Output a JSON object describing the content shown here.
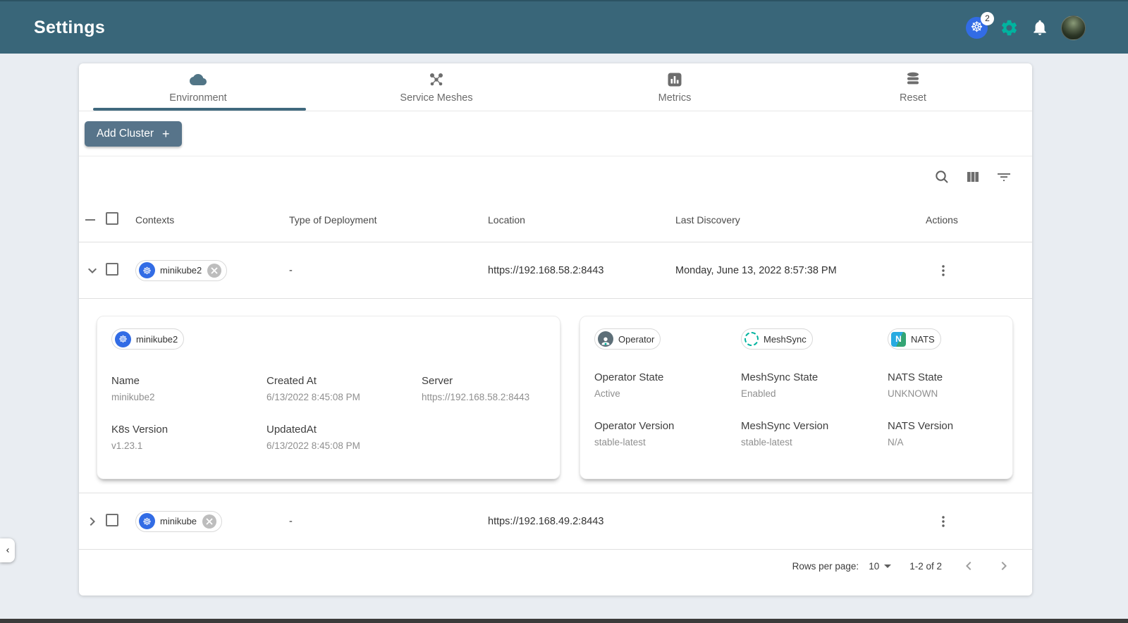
{
  "header": {
    "title": "Settings",
    "context_badge": "2"
  },
  "tabs": [
    {
      "label": "Environment",
      "icon": "cloud",
      "active": true
    },
    {
      "label": "Service Meshes",
      "icon": "mesh",
      "active": false
    },
    {
      "label": "Metrics",
      "icon": "bar-chart",
      "active": false
    },
    {
      "label": "Reset",
      "icon": "database",
      "active": false
    }
  ],
  "actions_bar": {
    "add_cluster": "Add Cluster",
    "plus": "+"
  },
  "table": {
    "columns": {
      "contexts": "Contexts",
      "type": "Type of Deployment",
      "location": "Location",
      "discovery": "Last Discovery",
      "actions": "Actions"
    },
    "rows": [
      {
        "name": "minikube2",
        "type": "-",
        "location": "https://192.168.58.2:8443",
        "discovery": "Monday, June 13, 2022 8:57:38 PM"
      },
      {
        "name": "minikube",
        "type": "-",
        "location": "https://192.168.49.2:8443",
        "discovery": ""
      }
    ]
  },
  "detail": {
    "chip": "minikube2",
    "cluster_fields": [
      {
        "label": "Name",
        "value": "minikube2"
      },
      {
        "label": "Created At",
        "value": "6/13/2022 8:45:08 PM"
      },
      {
        "label": "Server",
        "value": "https://192.168.58.2:8443"
      },
      {
        "label": "K8s Version",
        "value": "v1.23.1"
      },
      {
        "label": "UpdatedAt",
        "value": "6/13/2022 8:45:08 PM"
      }
    ],
    "component_chips": [
      {
        "label": "Operator"
      },
      {
        "label": "MeshSync"
      },
      {
        "label": "NATS"
      }
    ],
    "component_fields": [
      {
        "label": "Operator State",
        "value": "Active"
      },
      {
        "label": "MeshSync State",
        "value": "Enabled"
      },
      {
        "label": "NATS State",
        "value": "UNKNOWN"
      },
      {
        "label": "Operator Version",
        "value": "stable-latest"
      },
      {
        "label": "MeshSync Version",
        "value": "stable-latest"
      },
      {
        "label": "NATS Version",
        "value": "N/A"
      }
    ]
  },
  "pagination": {
    "rows_per_page_label": "Rows per page:",
    "rows_per_page_value": "10",
    "range": "1-2 of 2"
  },
  "colors": {
    "header_bg": "#396679",
    "accent_green": "#00B39F",
    "k8s_blue": "#326CE5",
    "button_bg": "#57748A",
    "tab_indicator": "#40697E"
  }
}
